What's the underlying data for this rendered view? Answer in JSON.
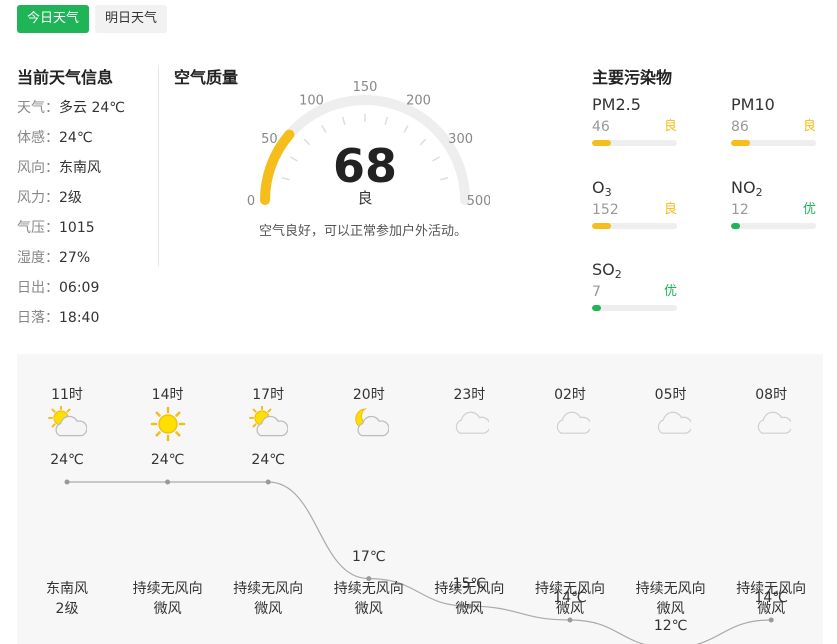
{
  "tabs": [
    "今日天气",
    "明日天气"
  ],
  "current": {
    "title": "当前天气信息",
    "rows": [
      {
        "k": "天气：",
        "v": "多云 24℃"
      },
      {
        "k": "体感：",
        "v": "24℃"
      },
      {
        "k": "风向：",
        "v": "东南风"
      },
      {
        "k": "风力：",
        "v": "2级"
      },
      {
        "k": "气压：",
        "v": "1015"
      },
      {
        "k": "湿度：",
        "v": "27%"
      },
      {
        "k": "日出：",
        "v": "06:09"
      },
      {
        "k": "日落：",
        "v": "18:40"
      }
    ]
  },
  "aqi": {
    "title": "空气质量",
    "value": "68",
    "level": "良",
    "description": "空气良好，可以正常参加户外活动。",
    "scale_labels": [
      "0",
      "50",
      "100",
      "150",
      "200",
      "300",
      "500"
    ],
    "fraction": 0.227,
    "color": "#f5be1b"
  },
  "pollutants": {
    "title": "主要污染物",
    "items": [
      {
        "name": "PM2.5",
        "sub": "",
        "value": "46",
        "level": "良",
        "fill": 0.22,
        "color": "#f5be1b"
      },
      {
        "name": "PM10",
        "sub": "",
        "value": "86",
        "level": "良",
        "fill": 0.22,
        "color": "#f5be1b"
      },
      {
        "name": "O",
        "sub": "3",
        "value": "152",
        "level": "良",
        "fill": 0.22,
        "color": "#f5be1b"
      },
      {
        "name": "NO",
        "sub": "2",
        "value": "12",
        "level": "优",
        "fill": 0.1,
        "color": "#1fb456"
      },
      {
        "name": "SO",
        "sub": "2",
        "value": "7",
        "level": "优",
        "fill": 0.1,
        "color": "#1fb456"
      }
    ]
  },
  "forecast": {
    "hours": [
      {
        "time": "11时",
        "icon": "partly-cloudy-day-icon",
        "temp": 24,
        "temp_label": "24℃",
        "wind1": "东南风",
        "wind2": "2级"
      },
      {
        "time": "14时",
        "icon": "sun-icon",
        "temp": 24,
        "temp_label": "24℃",
        "wind1": "持续无风向",
        "wind2": "微风"
      },
      {
        "time": "17时",
        "icon": "partly-cloudy-day-icon",
        "temp": 24,
        "temp_label": "24℃",
        "wind1": "持续无风向",
        "wind2": "微风"
      },
      {
        "time": "20时",
        "icon": "moon-cloud-icon",
        "temp": 17,
        "temp_label": "17℃",
        "wind1": "持续无风向",
        "wind2": "微风"
      },
      {
        "time": "23时",
        "icon": "cloud-icon",
        "temp": 15,
        "temp_label": "15℃",
        "wind1": "持续无风向",
        "wind2": "微风"
      },
      {
        "time": "02时",
        "icon": "cloud-icon",
        "temp": 14,
        "temp_label": "14℃",
        "wind1": "持续无风向",
        "wind2": "微风"
      },
      {
        "time": "05时",
        "icon": "cloud-icon",
        "temp": 12,
        "temp_label": "12℃",
        "wind1": "持续无风向",
        "wind2": "微风"
      },
      {
        "time": "08时",
        "icon": "cloud-icon",
        "temp": 14,
        "temp_label": "14℃",
        "wind1": "持续无风向",
        "wind2": "微风"
      }
    ]
  }
}
